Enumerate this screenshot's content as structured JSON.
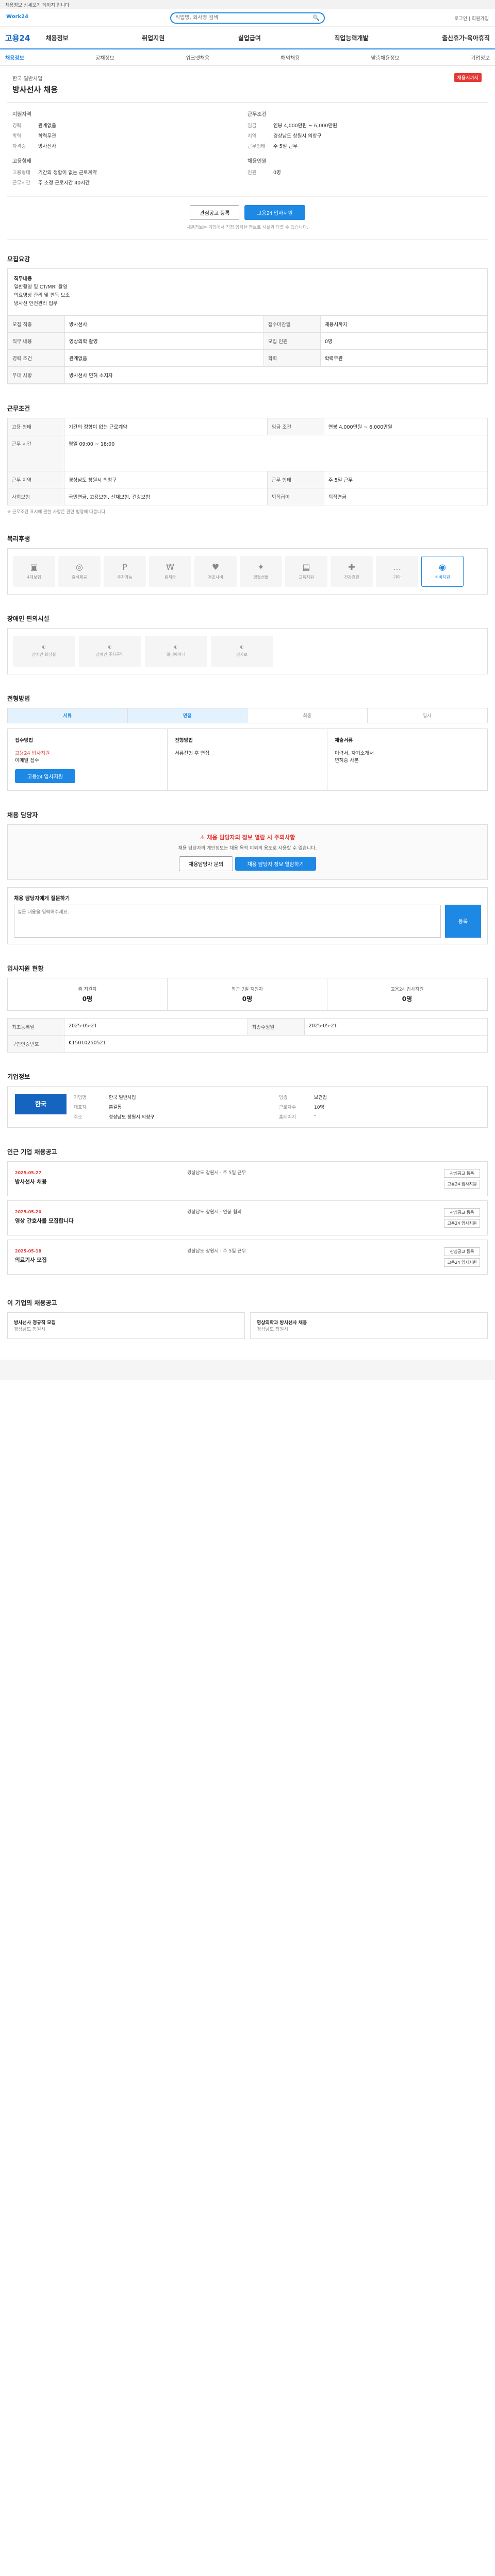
{
  "topbar": {
    "text": "채용정보 상세보기 페이지 입니다"
  },
  "search": {
    "placeholder": "직업명, 회사명 검색",
    "logo": "Work24",
    "util": "로그인 | 회원가입"
  },
  "gnb": {
    "brand": "고용24",
    "menu": [
      "채용정보",
      "취업지원",
      "실업급여",
      "직업능력개발",
      "출산휴가·육아휴직"
    ]
  },
  "subnav": [
    "채용정보",
    "공채정보",
    "워크넷채용",
    "해외채용",
    "맞춤채용정보",
    "기업정보"
  ],
  "job": {
    "company": "한국 일반사업",
    "title": "방사선사 채용",
    "badge": "채용시까지",
    "summary_left_title": "지원자격",
    "summary_left": [
      {
        "k": "경력",
        "v": "관계없음"
      },
      {
        "k": "학력",
        "v": "학력무관"
      },
      {
        "k": "자격증",
        "v": "방사선사"
      }
    ],
    "summary_right_title": "근무조건",
    "summary_right": [
      {
        "k": "임금",
        "v": "연봉 4,000만원 ~ 6,000만원"
      },
      {
        "k": "지역",
        "v": "경상남도 창원시 의창구"
      },
      {
        "k": "근무형태",
        "v": "주 5일 근무"
      }
    ],
    "summary_left2_title": "고용형태",
    "summary_left2": [
      {
        "k": "고용형태",
        "v": "기간의 정함이 없는 근로계약"
      },
      {
        "k": "근무시간",
        "v": "주 소정 근로시간 40시간"
      }
    ],
    "summary_right2_title": "채용인원",
    "summary_right2": [
      {
        "k": "인원",
        "v": "0명"
      }
    ]
  },
  "buttons": {
    "scrap": "관심공고 등록",
    "apply": "고용24 입사지원"
  },
  "note": "채용정보는 기업에서 직접 입력한 정보로 사실과 다를 수 있습니다.",
  "sections": {
    "recruit": "모집요강",
    "work": "근무조건",
    "welfare": "복리후생",
    "disabled": "장애인 편의시설",
    "process": "전형방법",
    "contact": "채용 담당자",
    "stats": "입사지원 현황",
    "company": "기업정보",
    "related": "인근 기업 채용공고",
    "similar": "이 기업의 채용공고"
  },
  "recruit": {
    "duty_title": "직무내용",
    "duty": [
      "일반촬영 및 CT/MRI 촬영",
      "의료영상 관리 및 판독 보조",
      "방사선 안전관리 업무"
    ],
    "rows": [
      {
        "k": "모집 직종",
        "v": "방사선사",
        "k2": "접수마감일",
        "v2": "채용시까지"
      },
      {
        "k": "직무 내용",
        "v": "영상의학 촬영",
        "k2": "모집 인원",
        "v2": "0명"
      },
      {
        "k": "경력 조건",
        "v": "관계없음",
        "k2": "학력",
        "v2": "학력무관"
      },
      {
        "k": "우대 사항",
        "v": "방사선사 면허 소지자",
        "k2": "",
        "v2": ""
      }
    ]
  },
  "work": {
    "rows": [
      {
        "k": "고용 형태",
        "v": "기간의 정함이 없는 근로계약",
        "k2": "임금 조건",
        "v2": "연봉 4,000만원 ~ 6,000만원"
      },
      {
        "k": "근무 시간",
        "v": "평일 09:00 ~ 18:00",
        "k2": "",
        "v2": ""
      },
      {
        "k": "근무 지역",
        "v": "경상남도 창원시 의창구",
        "k2": "근무 형태",
        "v2": "주 5일 근무"
      },
      {
        "k": "사회보험",
        "v": "국민연금, 고용보험, 산재보험, 건강보험",
        "k2": "퇴직급여",
        "v2": "퇴직연금"
      }
    ],
    "disclaimer": "※ 근로조건 표시에 관한 사항은 관련 법령에 따릅니다."
  },
  "welfare_items": [
    "4대보험",
    "중식제공",
    "주차가능",
    "퇴직금",
    "경조사비",
    "명절선물",
    "교육지원",
    "건강검진",
    "기타",
    "식비지원"
  ],
  "disabled_items": [
    "장애인 화장실",
    "장애인 주차구역",
    "엘리베이터",
    "경사로"
  ],
  "process": {
    "steps": [
      "서류",
      "면접",
      "최종",
      "입사"
    ],
    "cols": [
      {
        "title": "접수방법",
        "lines": [
          "고용24 입사지원",
          "이메일 접수"
        ]
      },
      {
        "title": "전형방법",
        "lines": [
          "서류전형 후 면접"
        ]
      },
      {
        "title": "제출서류",
        "lines": [
          "이력서, 자기소개서",
          "면허증 사본"
        ]
      }
    ]
  },
  "contact": {
    "warn": "채용 담당자의 정보 열람 시 주의사항",
    "body": "채용 담당자의 개인정보는 채용 목적 이외의 용도로 사용할 수 없습니다.",
    "btn1": "채용담당자 문의",
    "btn2": "채용 담당자 정보 열람하기",
    "qa_title": "채용 담당자에게 질문하기",
    "qa_placeholder": "질문 내용을 입력해주세요.",
    "qa_button": "등록"
  },
  "stats": [
    {
      "label": "총 지원자",
      "value": "0명"
    },
    {
      "label": "최근 7일 지원자",
      "value": "0명"
    },
    {
      "label": "고용24 입사지원",
      "value": "0명"
    }
  ],
  "info_rows": [
    {
      "k": "최초등록일",
      "v": "2025-05-21",
      "k2": "최종수정일",
      "v2": "2025-05-21"
    },
    {
      "k": "구인인증번호",
      "v": "K15010250521",
      "k2": "",
      "v2": ""
    }
  ],
  "company": {
    "logo": "한국",
    "details": [
      {
        "k": "기업명",
        "v": "한국 일반사업"
      },
      {
        "k": "업종",
        "v": "보건업"
      },
      {
        "k": "대표자",
        "v": "홍길동"
      },
      {
        "k": "근로자수",
        "v": "10명"
      },
      {
        "k": "주소",
        "v": "경상남도 창원시 의창구"
      },
      {
        "k": "홈페이지",
        "v": "-"
      }
    ]
  },
  "related": [
    {
      "date": "2025-05-27",
      "title": "방사선사 채용",
      "meta": "경상남도 창원시 · 주 5일 근무"
    },
    {
      "date": "2025-05-20",
      "title": "영상 간호사를 모집합니다",
      "meta": "경상남도 창원시 · 연봉 협의"
    },
    {
      "date": "2025-05-18",
      "title": "의료기사 모집",
      "meta": "경상남도 창원시 · 주 5일 근무"
    }
  ],
  "similar": [
    {
      "title": "방사선사 정규직 모집",
      "meta": "경상남도 창원시"
    },
    {
      "title": "영상의학과 방사선사 채용",
      "meta": "경상남도 창원시"
    }
  ]
}
